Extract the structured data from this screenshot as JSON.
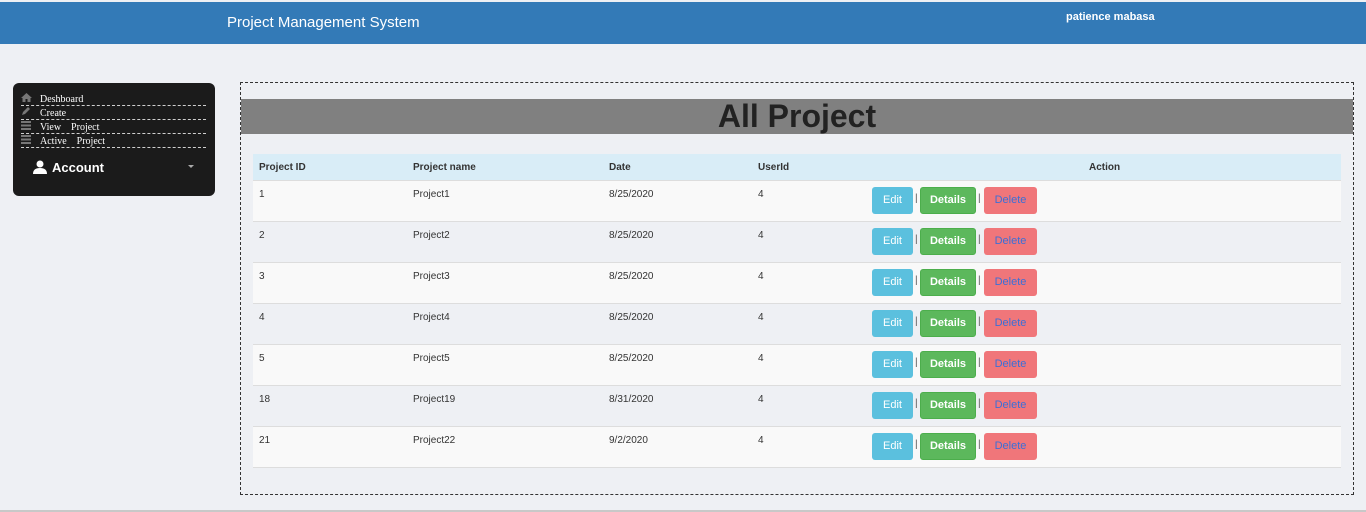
{
  "header": {
    "app_title": "Project Management System",
    "user_name": "patience mabasa"
  },
  "sidebar": {
    "items": [
      {
        "label": "Deshboard",
        "icon": "home-icon"
      },
      {
        "label": "Create",
        "icon": "pencil-icon"
      },
      {
        "label": "View    Project",
        "icon": "list-icon"
      },
      {
        "label": "Active    Project",
        "icon": "list-icon"
      }
    ],
    "account_label": "Account"
  },
  "main": {
    "page_title": "All Project",
    "columns": [
      "Project ID",
      "Project name",
      "Date",
      "UserId",
      "Action"
    ],
    "rows": [
      {
        "id": "1",
        "name": "Project1",
        "date": "8/25/2020",
        "user_id": "4"
      },
      {
        "id": "2",
        "name": "Project2",
        "date": "8/25/2020",
        "user_id": "4"
      },
      {
        "id": "3",
        "name": "Project3",
        "date": "8/25/2020",
        "user_id": "4"
      },
      {
        "id": "4",
        "name": "Project4",
        "date": "8/25/2020",
        "user_id": "4"
      },
      {
        "id": "5",
        "name": "Project5",
        "date": "8/25/2020",
        "user_id": "4"
      },
      {
        "id": "18",
        "name": "Project19",
        "date": "8/31/2020",
        "user_id": "4"
      },
      {
        "id": "21",
        "name": "Project22",
        "date": "9/2/2020",
        "user_id": "4"
      }
    ],
    "actions": {
      "edit": "Edit",
      "details": "Details",
      "delete": "Delete",
      "separator": "|"
    }
  },
  "colors": {
    "header": "#337ab7",
    "sidebar": "#1b1b1b",
    "edit": "#5bc0de",
    "details": "#5cb85c",
    "delete": "#f0767a",
    "banner": "#808080",
    "table_head": "#d9edf7"
  }
}
